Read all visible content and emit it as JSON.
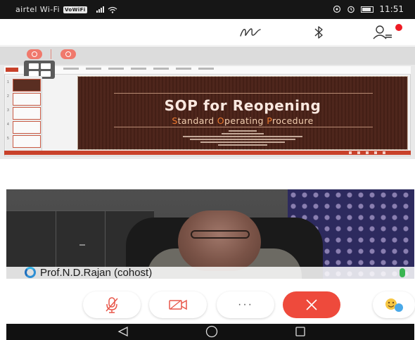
{
  "status_bar": {
    "carrier": "airtel Wi-Fi",
    "wifi_badge": "VoWiFi",
    "time": "11:51",
    "signal_icon": "cell-signal-icon",
    "wifi_icon": "wifi-icon",
    "battery_icon": "battery-icon"
  },
  "top_bar": {
    "annotate_icon": "annotate-scribble-icon",
    "bluetooth_icon": "bluetooth-audio-icon",
    "participants_icon": "participants-icon",
    "indicator_color": "#ee1b24"
  },
  "share_toolbar": {
    "mic_icon": "mic-muted-icon",
    "camera_icon": "camera-icon",
    "accent": "#f0796c",
    "view_toggle_icon": "grid-view-icon"
  },
  "slide": {
    "title": "SOP for Reopening",
    "subtitle_parts": [
      {
        "text": "S",
        "highlight": true
      },
      {
        "text": "tandard ",
        "highlight": false
      },
      {
        "text": "O",
        "highlight": true
      },
      {
        "text": "perating ",
        "highlight": false
      },
      {
        "text": "P",
        "highlight": true
      },
      {
        "text": "rocedure",
        "highlight": false
      }
    ],
    "background": "#4a2218",
    "highlight_color": "#f07a2e"
  },
  "video": {
    "participant_name": "Prof.N.D.Rajan (cohost)",
    "audio_indicator_color": "#3ab552"
  },
  "controls": {
    "mute_icon": "mic-muted-icon",
    "video_icon": "camera-icon",
    "more_label": "···",
    "end_icon": "end-call-icon",
    "end_color": "#ee4a3c",
    "reactions_icon": "emoji-reactions-icon"
  },
  "nav_bar": {
    "back_icon": "back-triangle-icon",
    "home_icon": "home-circle-icon",
    "recents_icon": "recents-square-icon"
  }
}
